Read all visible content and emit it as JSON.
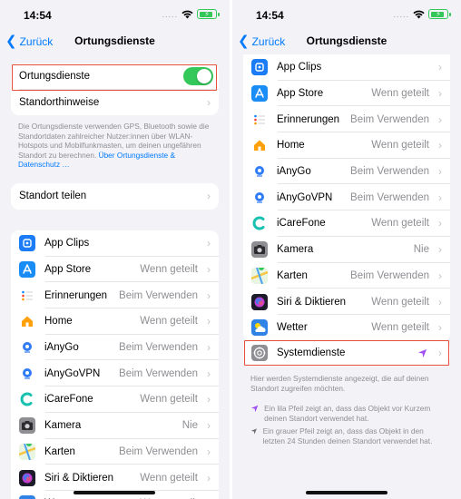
{
  "status": {
    "time": "14:54",
    "signal": "....."
  },
  "nav": {
    "back_label": "Zurück",
    "title": "Ortungsdienste"
  },
  "left": {
    "location_services": {
      "label": "Ortungsdienste",
      "toggle_on": true
    },
    "hints_label": "Standorthinweise",
    "description": "Die Ortungsdienste verwenden GPS, Bluetooth sowie die Standortdaten zahlreicher Nutzer:innen über WLAN-Hotspots und Mobilfunkmasten, um deinen ungefähren Standort zu berechnen.",
    "description_link": "Über Ortungs­dienste & Datenschutz …",
    "share_location_label": "Standort teilen"
  },
  "apps": [
    {
      "name": "App Clips",
      "value": "",
      "icon": "app-clips-icon",
      "color": "#1c7cf5"
    },
    {
      "name": "App Store",
      "value": "Wenn geteilt",
      "icon": "app-store-icon",
      "color": "#1a8cf6"
    },
    {
      "name": "Erinnerungen",
      "value": "Beim Verwenden",
      "icon": "reminders-icon",
      "color": "#ffffff"
    },
    {
      "name": "Home",
      "value": "Wenn geteilt",
      "icon": "home-icon",
      "color": "#ffffff"
    },
    {
      "name": "iAnyGo",
      "value": "Beim Verwenden",
      "icon": "ianygo-icon",
      "color": "#ffffff"
    },
    {
      "name": "iAnyGoVPN",
      "value": "Beim Verwenden",
      "icon": "ianygovpn-icon",
      "color": "#ffffff"
    },
    {
      "name": "iCareFone",
      "value": "Wenn geteilt",
      "icon": "icarefone-icon",
      "color": "#ffffff"
    },
    {
      "name": "Kamera",
      "value": "Nie",
      "icon": "camera-icon",
      "color": "#8e8e93"
    },
    {
      "name": "Karten",
      "value": "Beim Verwenden",
      "icon": "maps-icon",
      "color": "#ffffff"
    },
    {
      "name": "Siri & Diktieren",
      "value": "Wenn geteilt",
      "icon": "siri-icon",
      "color": "#1b1b2a"
    },
    {
      "name": "Wetter",
      "value": "Wenn geteilt",
      "icon": "weather-icon",
      "color": "#2f83e6"
    }
  ],
  "right": {
    "system_services": {
      "label": "Systemdienste",
      "icon": "settings-gear-icon",
      "arrow_color": "#a250f2"
    },
    "info_text": "Hier werden Systemdienste angezeigt, die auf deinen Standort zugreifen möchten.",
    "purple_note": "Ein lila Pfeil zeigt an, dass das Objekt vor Kurzem deinen Standort verwendet hat.",
    "gray_note": "Ein grauer Pfeil zeigt an, dass das Objekt in den letzten 24 Stunden deinen Standort verwendet hat."
  },
  "colors": {
    "accent": "#007aff",
    "toggle_on": "#34c759",
    "highlight": "#e4513a",
    "purple_arrow": "#a250f2",
    "gray_arrow": "#8e8e93"
  }
}
